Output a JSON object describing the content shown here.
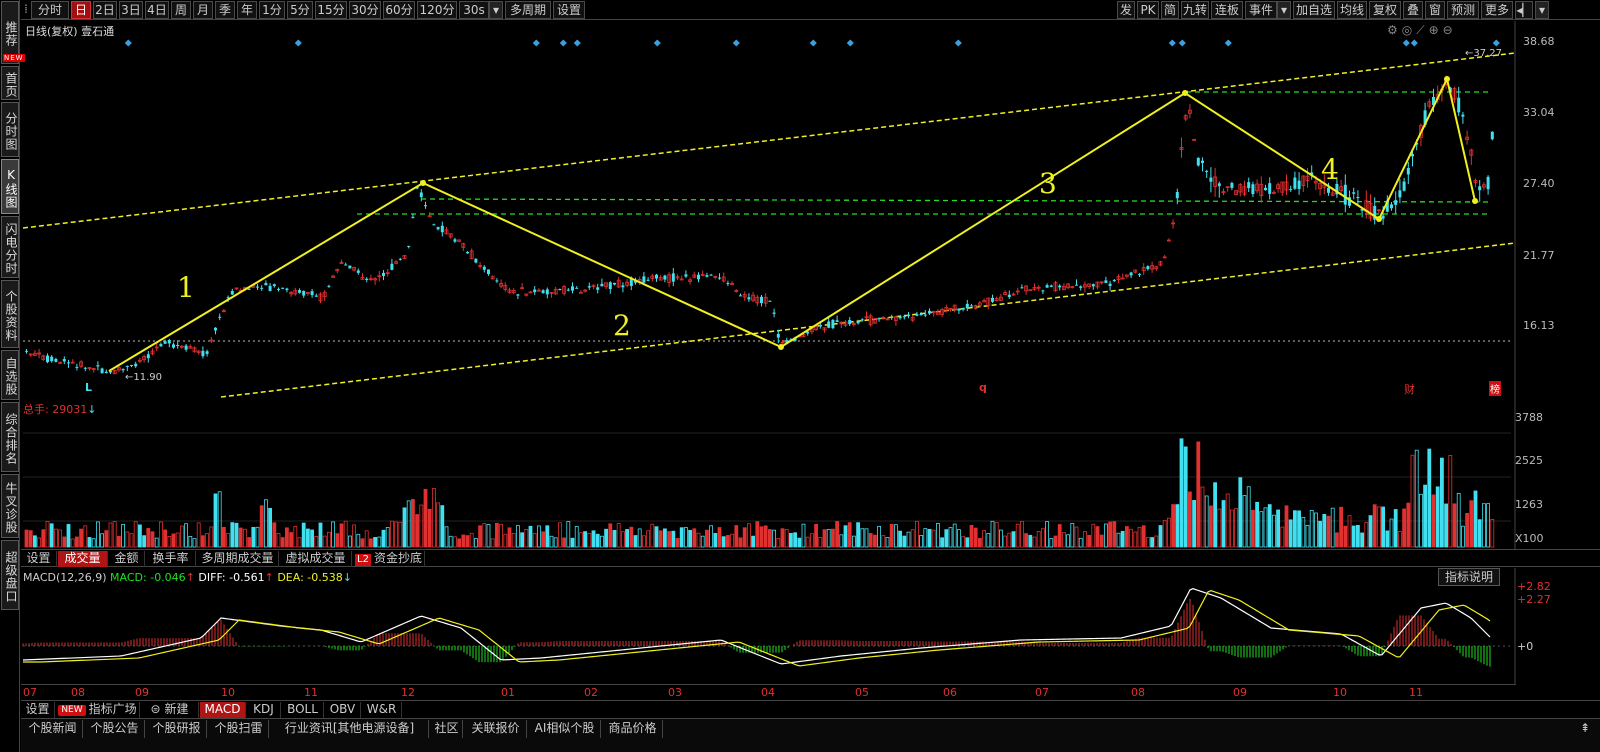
{
  "left_nav": [
    "推荐",
    "首页",
    "分时图",
    "K线图",
    "闪电分时",
    "个股资料",
    "自选股",
    "综合排名",
    "牛叉诊股",
    "超级盘口"
  ],
  "left_nav_new": "NEW",
  "top_periods": [
    "分时",
    "日",
    "2日",
    "3日",
    "4日",
    "周",
    "月",
    "季",
    "年",
    "1分",
    "5分",
    "15分",
    "30分",
    "60分",
    "120分",
    "30s",
    "多周期",
    "设置"
  ],
  "top_right": [
    "发",
    "PK",
    "简",
    "九转",
    "连板",
    "事件",
    "加自选",
    "均线",
    "复权",
    "叠",
    "窗",
    "预测",
    "更多"
  ],
  "chart_title": "日线(复权)  壹石通",
  "price_axis": [
    "38.68",
    "33.04",
    "27.40",
    "21.77",
    "16.13"
  ],
  "price_high": "37.27",
  "price_low": "11.90",
  "wave_labels": [
    "1",
    "2",
    "3",
    "4"
  ],
  "markers": {
    "left": "L",
    "q": "q",
    "cai": "财",
    "bang": "榜"
  },
  "volume": {
    "label": "总手: 29031",
    "axis": [
      "3788",
      "2525",
      "1263",
      "X100"
    ]
  },
  "sub_tabs": [
    "设置",
    "成交量",
    "金额",
    "换手率",
    "多周期成交量",
    "虚拟成交量",
    "资金抄底"
  ],
  "l2": "L2",
  "macd": {
    "title": "MACD(12,26,9)",
    "macd_val": "MACD: -0.046",
    "diff_val": "DIFF: -0.561",
    "dea_val": "DEA: -0.538",
    "axis": [
      "+2.82",
      "+2.27",
      "+0"
    ],
    "explain": "指标说明"
  },
  "months": [
    "07",
    "08",
    "09",
    "10",
    "11",
    "12",
    "01",
    "02",
    "03",
    "04",
    "05",
    "06",
    "07",
    "08",
    "09",
    "10",
    "11"
  ],
  "indicator_tabs": [
    "设置",
    "指标广场",
    "新建",
    "MACD",
    "KDJ",
    "BOLL",
    "OBV",
    "W&R"
  ],
  "indicator_new": "NEW",
  "news_tabs": [
    "个股新闻",
    "个股公告",
    "个股研报",
    "个股扫雷",
    "行业资讯[其他电源设备]",
    "社区",
    "关联报价",
    "AI相似个股",
    "商品价格"
  ],
  "colors": {
    "up": "#e03030",
    "down": "#40e0f0",
    "yellow": "#f0f020",
    "green": "#20e020",
    "white": "#ffffff"
  }
}
